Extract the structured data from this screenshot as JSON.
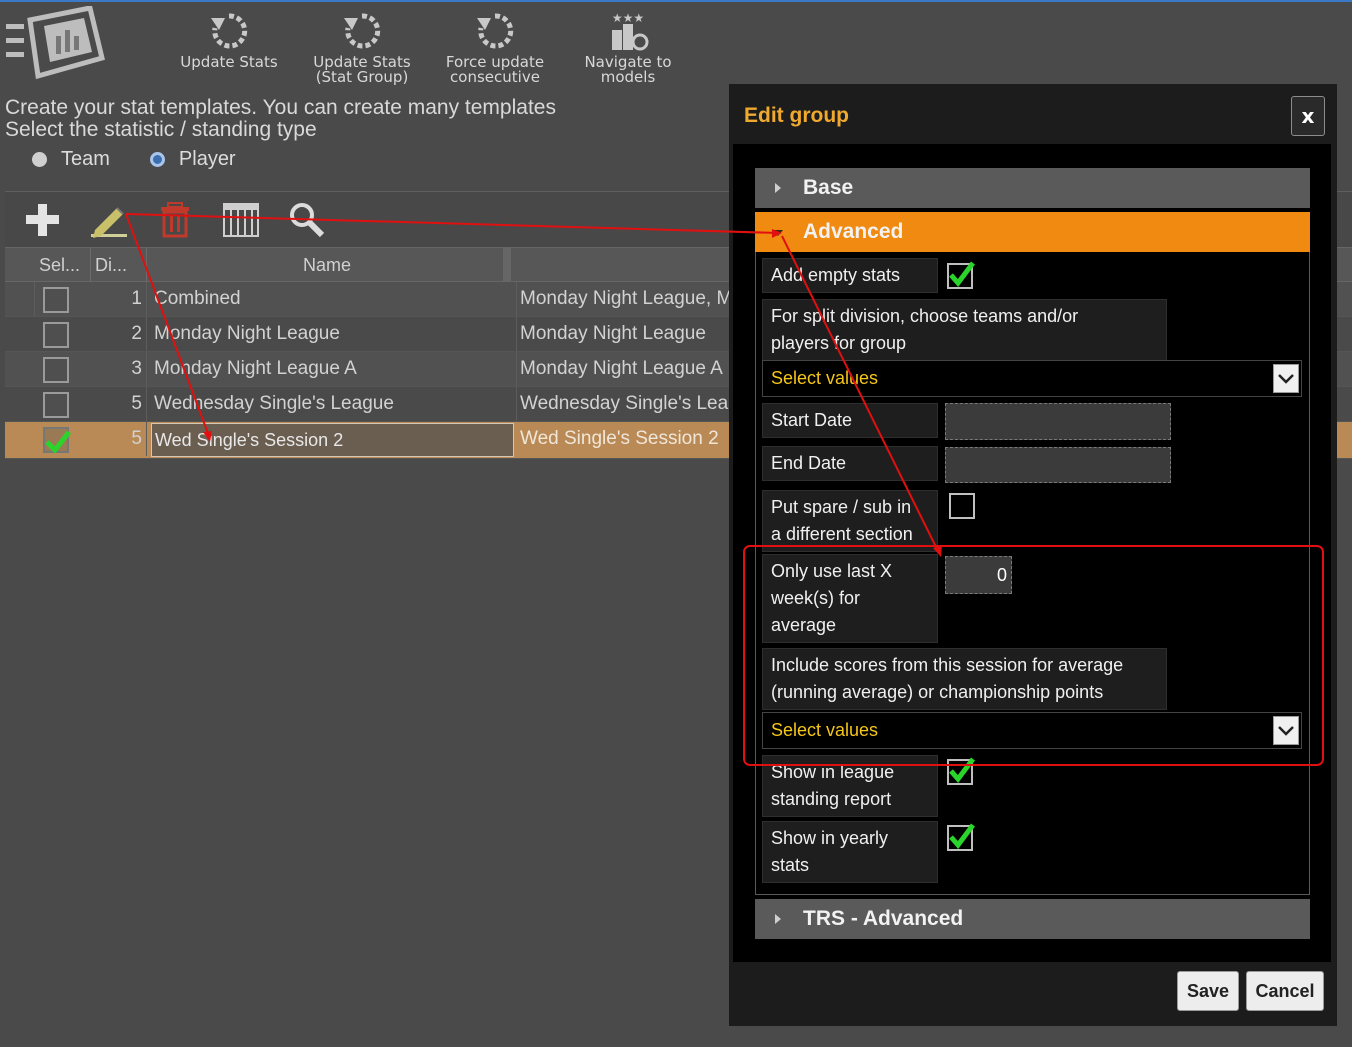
{
  "toolbar": {
    "buttons": [
      {
        "line1": "Update Stats",
        "line2": ""
      },
      {
        "line1": "Update Stats",
        "line2": "(Stat Group)"
      },
      {
        "line1": "Force update",
        "line2": "consecutive"
      },
      {
        "line1": "Navigate to",
        "line2": "models"
      }
    ]
  },
  "intro": {
    "line1": "Create your stat templates. You can create many templates",
    "line2": "Select the statistic / standing type"
  },
  "type_radio": {
    "options": [
      "Team",
      "Player"
    ],
    "selected": "Player"
  },
  "grid": {
    "columns": [
      "Sel...",
      "Di...",
      "Name",
      ""
    ],
    "rows": [
      {
        "selected": false,
        "division": "1",
        "name": "Combined",
        "description": "Monday Night League, M"
      },
      {
        "selected": false,
        "division": "2",
        "name": "Monday Night League",
        "description": "Monday Night League"
      },
      {
        "selected": false,
        "division": "3",
        "name": "Monday Night League A",
        "description": "Monday Night League A"
      },
      {
        "selected": false,
        "division": "5",
        "name": "Wednesday Single's League",
        "description": "Wednesday Single's Leag"
      },
      {
        "selected": true,
        "division": "5",
        "name": "Wed Single's Session 2",
        "description": "Wed Single's Session 2"
      }
    ]
  },
  "dialog": {
    "title": "Edit group",
    "close_label": "x",
    "sections": {
      "base": "Base",
      "advanced": "Advanced",
      "trs": "TRS - Advanced"
    },
    "fields": {
      "add_empty_stats": {
        "label": "Add empty stats",
        "checked": true
      },
      "split_division": {
        "label_line1": "For split division, choose teams and/or",
        "label_line2": "players for group",
        "placeholder": "Select values"
      },
      "start_date": {
        "label": "Start Date",
        "value": ""
      },
      "end_date": {
        "label": "End Date",
        "value": ""
      },
      "spare_sub": {
        "label_line1": "Put spare / sub in",
        "label_line2": "a different section",
        "checked": false
      },
      "last_x_weeks": {
        "label_line1": "Only use last X",
        "label_line2": "week(s) for",
        "label_line3": "average",
        "value": "0"
      },
      "include_scores": {
        "label_line1": "Include scores from this session for average",
        "label_line2": "(running average) or championship points",
        "placeholder": "Select values"
      },
      "show_league_report": {
        "label_line1": "Show in league",
        "label_line2": "standing report",
        "checked": true
      },
      "show_yearly": {
        "label_line1": "Show in yearly",
        "label_line2": "stats",
        "checked": true
      }
    },
    "save_label": "Save",
    "cancel_label": "Cancel"
  },
  "colors": {
    "accent": "#f08a10",
    "title": "#f0a92f",
    "select_text": "#f5c518",
    "annotation": "#e01010",
    "check": "#2bd42b"
  }
}
